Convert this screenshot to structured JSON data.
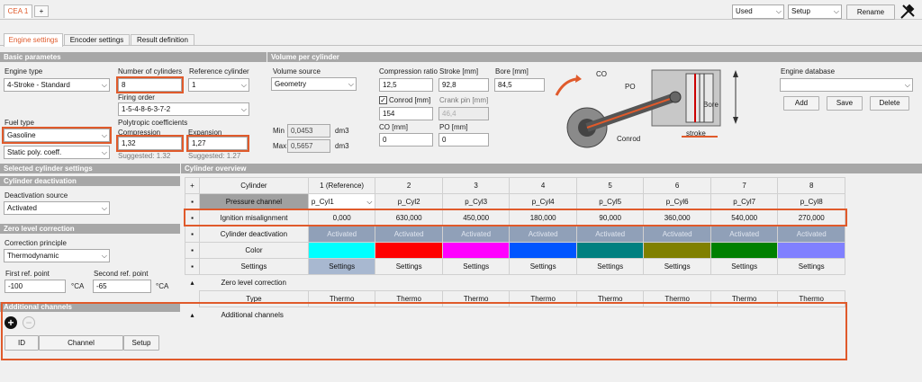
{
  "tabs": {
    "main": "CEA 1",
    "add": "+"
  },
  "top_controls": {
    "used": "Used",
    "setup": "Setup",
    "rename": "Rename"
  },
  "subtabs": [
    "Engine settings",
    "Encoder settings",
    "Result definition"
  ],
  "sections": {
    "basic": "Basic parametes",
    "volume": "Volume per cylinder",
    "selected": "Selected cylinder settings",
    "overview": "Cylinder overview",
    "deactivation": "Cylinder deactivation",
    "zero": "Zero level correction",
    "additional": "Additional channels"
  },
  "basic": {
    "engine_type_label": "Engine type",
    "engine_type": "4-Stroke - Standard",
    "num_cyl_label": "Number of cylinders",
    "num_cyl": "8",
    "ref_cyl_label": "Reference cylinder",
    "ref_cyl": "1",
    "firing_order_label": "Firing order",
    "firing_order": "1-5-4-8-6-3-7-2",
    "fuel_type_label": "Fuel type",
    "fuel_type": "Gasoline",
    "static_poly": "Static poly. coeff.",
    "polytropic_label": "Polytropic coefficients",
    "compression_label": "Compression",
    "compression": "1,32",
    "compression_suggested": "Suggested: 1.32",
    "expansion_label": "Expansion",
    "expansion": "1,27",
    "expansion_suggested": "Suggested: 1.27"
  },
  "volume": {
    "source_label": "Volume source",
    "source": "Geometry",
    "min_label": "Min",
    "min": "0,0453",
    "max_label": "Max",
    "max": "0,5657",
    "unit": "dm3",
    "cr_label": "Compression ratio",
    "cr": "12,5",
    "stroke_label": "Stroke [mm]",
    "stroke": "92,8",
    "bore_label": "Bore [mm]",
    "bore": "84,5",
    "conrod_label": "Conrod [mm]",
    "conrod": "154",
    "crankpin_label": "Crank pin [mm]",
    "crankpin": "46,4",
    "co_label": "CO [mm]",
    "co": "0",
    "po_label": "PO [mm]",
    "po": "0"
  },
  "diagram": {
    "co": "CO",
    "po": "PO",
    "bore": "Bore",
    "conrod": "Conrod",
    "stroke": "stroke"
  },
  "engine_db": {
    "label": "Engine database",
    "add": "Add",
    "save": "Save",
    "delete": "Delete"
  },
  "deact": {
    "source_label": "Deactivation source",
    "source": "Activated"
  },
  "zero": {
    "principle_label": "Correction principle",
    "principle": "Thermodynamic",
    "first_label": "First ref. point",
    "first": "-100",
    "second_label": "Second ref. point",
    "second": "-65",
    "unit": "°CA"
  },
  "additional": {
    "cols": [
      "ID",
      "Channel",
      "Setup"
    ]
  },
  "overview": {
    "cylinder_label": "Cylinder",
    "cols": [
      "1 (Reference)",
      "2",
      "3",
      "4",
      "5",
      "6",
      "7",
      "8"
    ],
    "pressure_label": "Pressure channel",
    "pressure": [
      "p_Cyl1",
      "p_Cyl2",
      "p_Cyl3",
      "p_Cyl4",
      "p_Cyl5",
      "p_Cyl6",
      "p_Cyl7",
      "p_Cyl8"
    ],
    "ignition_label": "Ignition misalignment",
    "ignition": [
      "0,000",
      "630,000",
      "450,000",
      "180,000",
      "90,000",
      "360,000",
      "540,000",
      "270,000"
    ],
    "deact_label": "Cylinder deactivation",
    "deact": [
      "Activated",
      "Activated",
      "Activated",
      "Activated",
      "Activated",
      "Activated",
      "Activated",
      "Activated"
    ],
    "color_label": "Color",
    "colors": [
      "#00ffff",
      "#ff0000",
      "#ff00ff",
      "#0055ff",
      "#008080",
      "#808000",
      "#008000",
      "#8080ff"
    ],
    "settings_label": "Settings",
    "settings": [
      "Settings",
      "Settings",
      "Settings",
      "Settings",
      "Settings",
      "Settings",
      "Settings",
      "Settings"
    ],
    "zero_label": "Zero level correction",
    "type_label": "Type",
    "types": [
      "Thermo",
      "Thermo",
      "Thermo",
      "Thermo",
      "Thermo",
      "Thermo",
      "Thermo",
      "Thermo"
    ],
    "additional_label": "Additional channels"
  }
}
